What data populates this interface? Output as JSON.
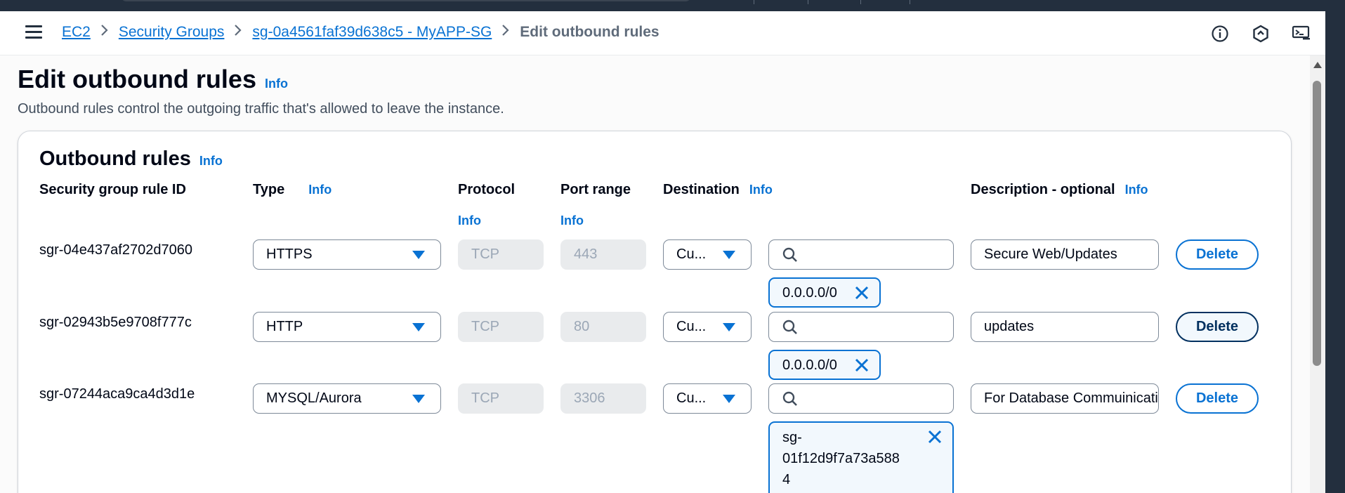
{
  "breadcrumb": {
    "items": [
      "EC2",
      "Security Groups",
      "sg-0a4561faf39d638c5 - MyAPP-SG"
    ],
    "current": "Edit outbound rules"
  },
  "icons": [
    "menu-icon",
    "chevron-right-icon",
    "info-circle-icon",
    "settings-hexagon-icon",
    "cloudshell-icon",
    "search-icon",
    "close-icon",
    "caret-down-icon"
  ],
  "page": {
    "title": "Edit outbound rules",
    "info": "Info",
    "description": "Outbound rules control the outgoing traffic that's allowed to leave the instance."
  },
  "section": {
    "title": "Outbound rules",
    "info": "Info"
  },
  "columns": {
    "rule_id": "Security group rule ID",
    "type": "Type",
    "protocol": "Protocol",
    "port_range": "Port range",
    "destination": "Destination",
    "description": "Description - optional",
    "info": "Info"
  },
  "rules": [
    {
      "id": "sgr-04e437af2702d7060",
      "type": "HTTPS",
      "protocol": "TCP",
      "port": "443",
      "destination_type": "Cu...",
      "search_placeholder": "",
      "token": "0.0.0.0/0",
      "description": "Secure Web/Updates",
      "delete": "Delete"
    },
    {
      "id": "sgr-02943b5e9708f777c",
      "type": "HTTP",
      "protocol": "TCP",
      "port": "80",
      "destination_type": "Cu...",
      "search_placeholder": "",
      "token": "0.0.0.0/0",
      "description": "updates",
      "delete": "Delete"
    },
    {
      "id": "sgr-07244aca9ca4d3d1e",
      "type": "MYSQL/Aurora",
      "protocol": "TCP",
      "port": "3306",
      "destination_type": "Cu...",
      "search_placeholder": "",
      "token_lines": [
        "sg-",
        "01f12d9f7a73a588",
        "4"
      ],
      "description": "For Database Commuinication",
      "delete": "Delete"
    }
  ],
  "colors": {
    "link": "#0972d3",
    "nav_dark": "#232f3e",
    "border": "#7d8998",
    "disabled_bg": "#e9ebed",
    "token_bg": "#f2f8fd"
  }
}
